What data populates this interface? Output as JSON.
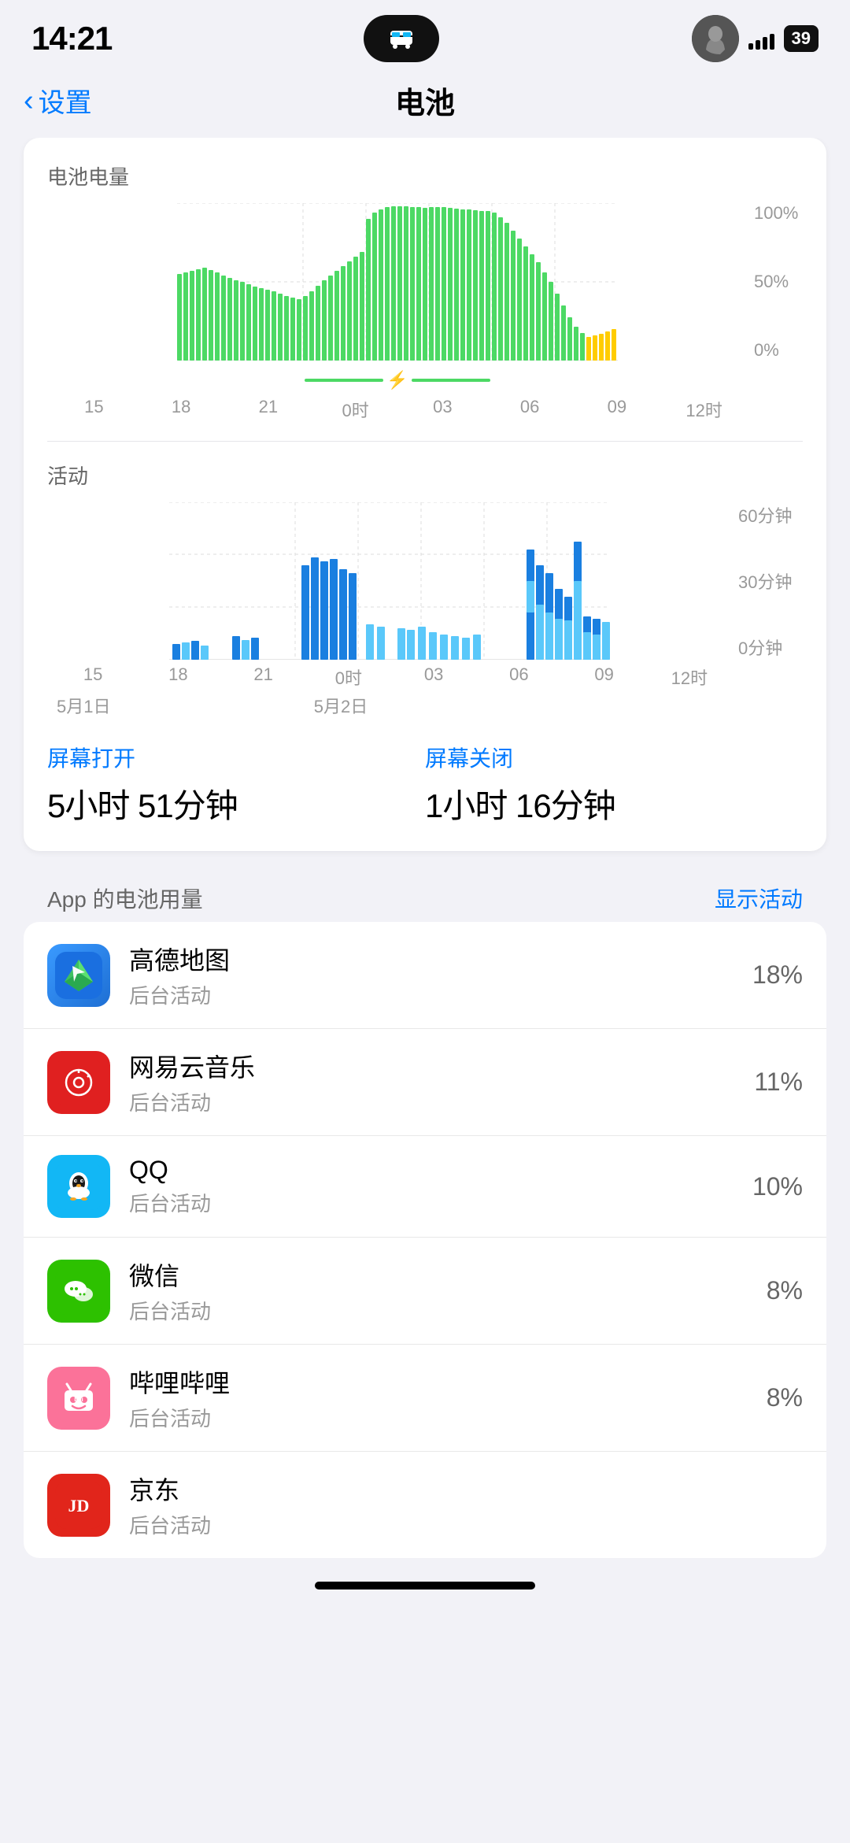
{
  "statusBar": {
    "time": "14:21",
    "batteryLevel": "39"
  },
  "nav": {
    "backLabel": "设置",
    "title": "电池"
  },
  "batteryChart": {
    "sectionLabel": "电池电量",
    "yLabels": [
      "100%",
      "50%",
      "0%"
    ],
    "xLabels": [
      "15",
      "18",
      "21",
      "0时",
      "03",
      "06",
      "09",
      "12时"
    ]
  },
  "activityChart": {
    "sectionLabel": "活动",
    "yLabels": [
      "60分钟",
      "30分钟",
      "0分钟"
    ],
    "xLabels": [
      "15",
      "18",
      "21",
      "0时",
      "03",
      "06",
      "09",
      "12时"
    ],
    "dateLabels": [
      "5月1日",
      "5月2日"
    ]
  },
  "screenTime": {
    "screenOnLabel": "屏幕打开",
    "screenOnValue": "5小时 51分钟",
    "screenOffLabel": "屏幕关闭",
    "screenOffValue": "1小时 16分钟"
  },
  "appBattery": {
    "sectionTitle": "App 的电池用量",
    "showActivityBtn": "显示活动",
    "apps": [
      {
        "name": "高德地图",
        "sub": "后台活动",
        "percent": "18%",
        "iconType": "gaode"
      },
      {
        "name": "网易云音乐",
        "sub": "后台活动",
        "percent": "11%",
        "iconType": "netease"
      },
      {
        "name": "QQ",
        "sub": "后台活动",
        "percent": "10%",
        "iconType": "qq"
      },
      {
        "name": "微信",
        "sub": "后台活动",
        "percent": "8%",
        "iconType": "wechat"
      },
      {
        "name": "哔哩哔哩",
        "sub": "后台活动",
        "percent": "8%",
        "iconType": "bilibili"
      },
      {
        "name": "京东",
        "sub": "后台活动",
        "percent": "",
        "iconType": "jd"
      }
    ]
  },
  "colors": {
    "green": "#4cd964",
    "yellow": "#ffcc00",
    "blue": "#007aff",
    "lightBlue": "#5ac8fa",
    "accent": "#007aff"
  }
}
